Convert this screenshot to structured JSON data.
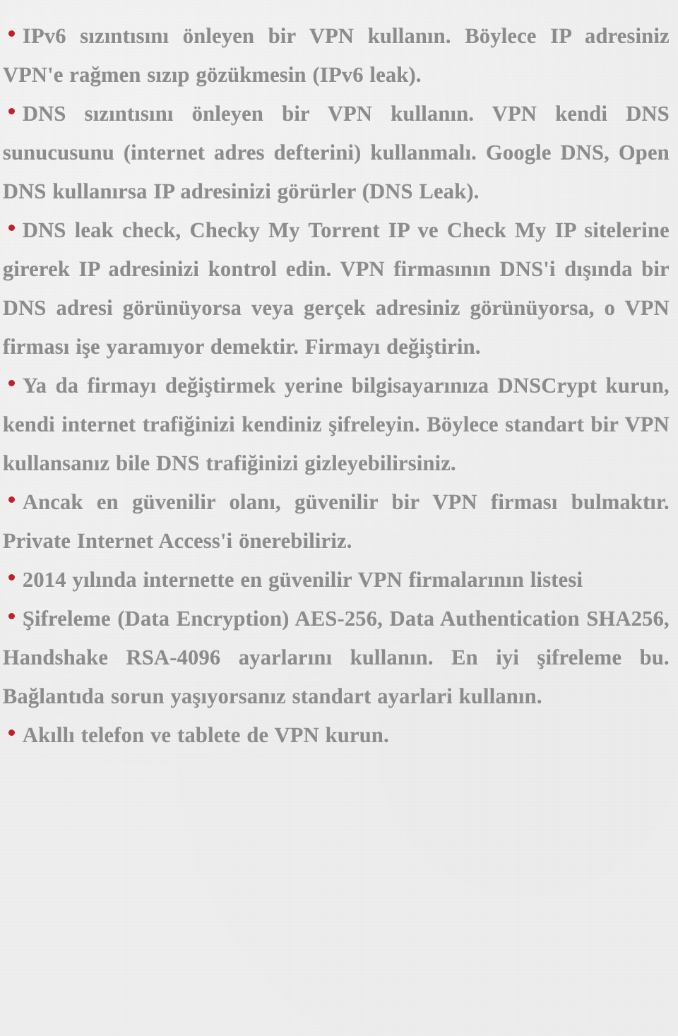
{
  "document": {
    "language": "tr",
    "background_color": "#eeeeee",
    "text_color": "#8c8c8c",
    "bullet_color": "#c0202a",
    "bullet_glyph": "•",
    "bullets": [
      {
        "id": "ipv6-leak",
        "text": "IPv6 sızıntısını önleyen bir VPN kullanın. Böylece IP adresiniz VPN'e rağmen sızıp gözükmesin (IPv6 leak)."
      },
      {
        "id": "dns-leak",
        "text": "DNS sızıntısını önleyen bir VPN kullanın. VPN kendi DNS sunucusunu (internet adres defterini) kullanmalı. Google DNS, Open DNS kullanırsa IP adresinizi görürler (DNS Leak)."
      },
      {
        "id": "dns-leak-check",
        "text": "DNS leak check, Checky My Torrent IP ve Check My IP sitelerine girerek IP adresinizi kontrol edin. VPN firmasının DNS'i dışında bir DNS adresi görünüyorsa veya gerçek adresiniz görünüyorsa, o VPN firması işe yaramıyor demektir. Firmayı değiştirin."
      },
      {
        "id": "dnscrypt",
        "text": "Ya da firmayı değiştirmek yerine bilgisayarınıza DNSCrypt kurun, kendi internet trafiğinizi kendiniz şifreleyin. Böylece standart bir VPN kullansanız bile DNS trafiğinizi gizleyebilirsiniz."
      },
      {
        "id": "trusted-vpn",
        "text": "Ancak en güvenilir olanı, güvenilir bir VPN firması bulmaktır. Private Internet Access'i önerebiliriz."
      },
      {
        "id": "vpn-list-2014",
        "text": "2014 yılında internette en güvenilir VPN firmalarının listesi"
      },
      {
        "id": "encryption-settings",
        "text": "Şifreleme (Data Encryption) AES-256, Data Authentication SHA256, Handshake RSA-4096 ayarlarını kullanın. En iyi şifreleme bu. Bağlantıda sorun yaşıyorsanız standart ayarlari kullanın."
      },
      {
        "id": "mobile-vpn",
        "text": "Akıllı telefon ve tablete de VPN kurun."
      }
    ]
  }
}
